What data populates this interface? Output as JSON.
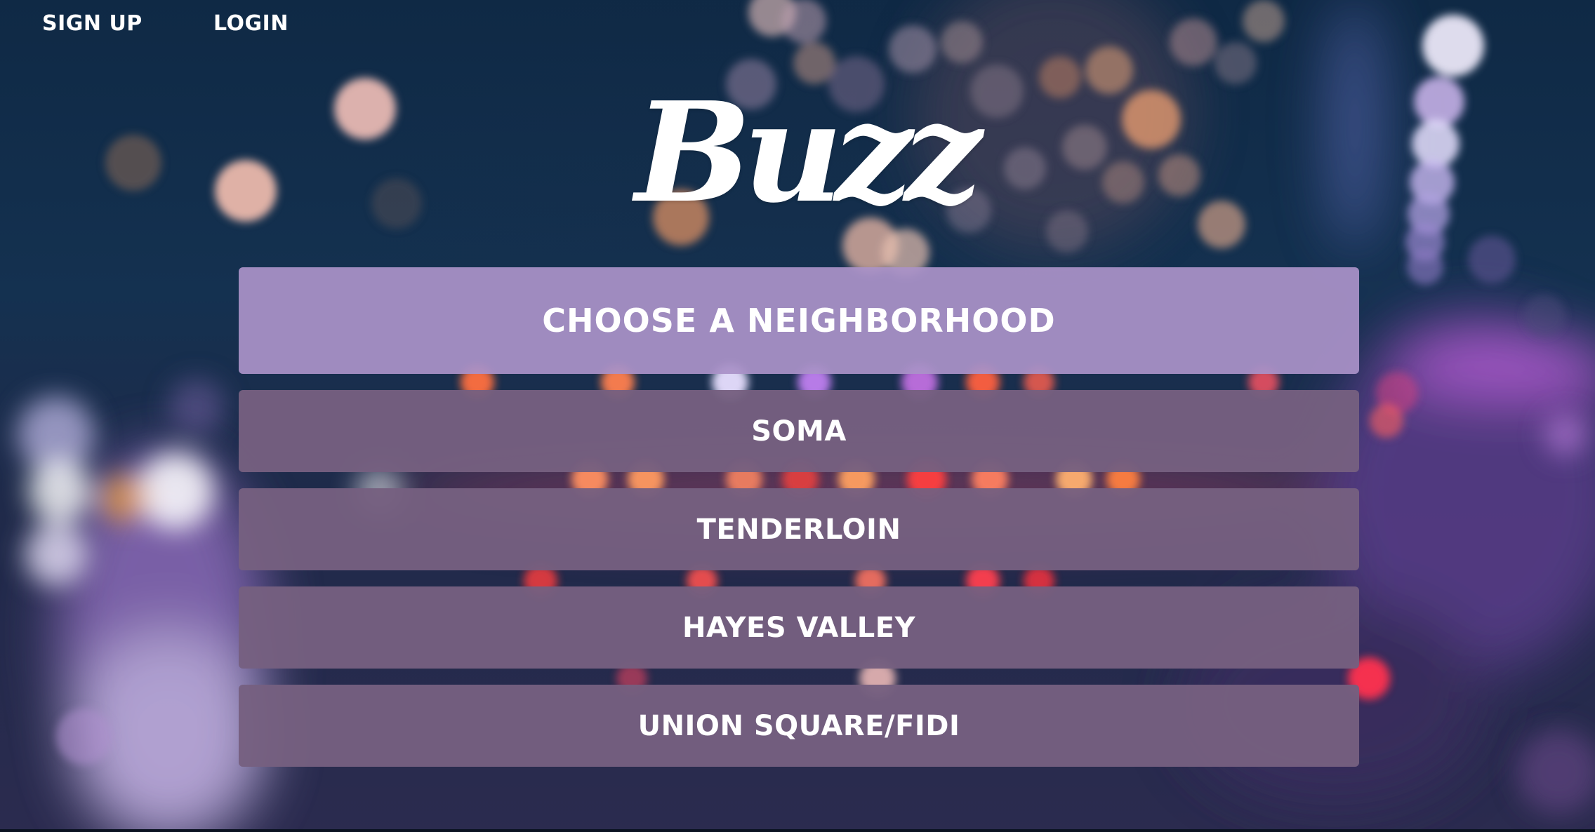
{
  "nav": {
    "signup_label": "SIGN UP",
    "login_label": "LOGIN"
  },
  "logo": {
    "text": "Buzz"
  },
  "panel": {
    "title": "CHOOSE A NEIGHBORHOOD",
    "options": [
      {
        "label": "SOMA"
      },
      {
        "label": "TENDERLOIN"
      },
      {
        "label": "HAYES VALLEY"
      },
      {
        "label": "UNION SQUARE/FIDI"
      }
    ]
  },
  "colors": {
    "header_bg": "#a592c5",
    "option_bg": "#756180",
    "text": "#ffffff",
    "background_dark": "#14243b"
  }
}
